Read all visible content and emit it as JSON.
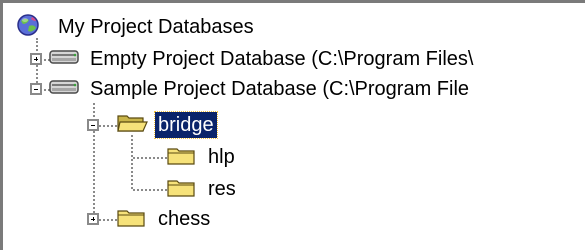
{
  "tree": {
    "root": {
      "label": "My Project Databases",
      "icon": "globe-icon"
    },
    "databases": [
      {
        "label": "Empty Project Database (C:\\Program Files\\",
        "icon": "database-drive-icon",
        "expanded": false
      },
      {
        "label": "Sample Project Database (C:\\Program File",
        "icon": "database-drive-icon",
        "expanded": true
      }
    ],
    "folders": [
      {
        "label": "bridge",
        "icon": "open-folder-icon",
        "expanded": true,
        "selected": true
      },
      {
        "label": "hlp",
        "icon": "folder-icon"
      },
      {
        "label": "res",
        "icon": "folder-icon"
      },
      {
        "label": "chess",
        "icon": "folder-icon",
        "expanded": false
      }
    ]
  },
  "colors": {
    "selection_bg": "#0a246a",
    "selection_fg": "#ffffff",
    "folder_yellow": "#f6e27a",
    "tree_line": "#8a8a8a"
  }
}
